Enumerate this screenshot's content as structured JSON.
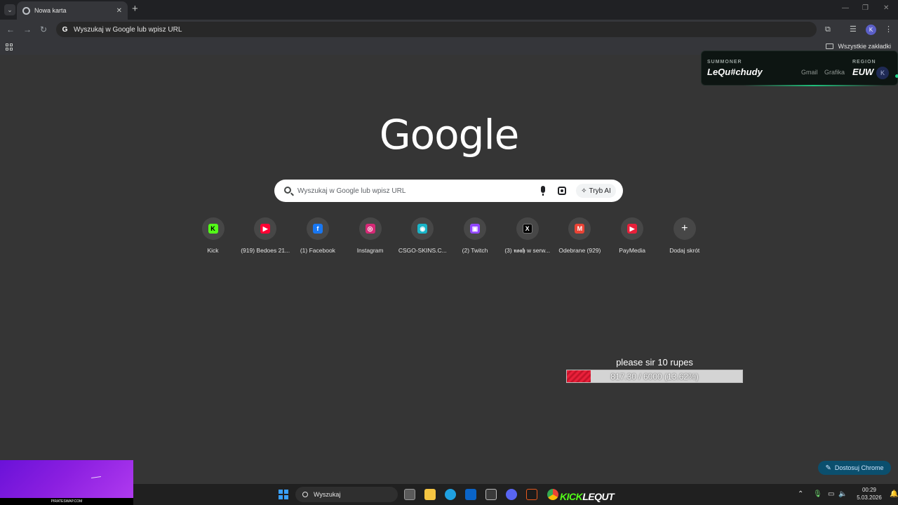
{
  "browser": {
    "tab": {
      "title": "Nowa karta"
    },
    "omnibox": {
      "text": "Wyszukaj w Google lub wpisz URL"
    },
    "profile_initial": "K",
    "bookmarks": {
      "all_label": "Wszystkie zakładki"
    }
  },
  "overlay": {
    "summoner_label": "SUMMONER",
    "summoner_name": "LeQu#chudy",
    "links": [
      "Gmail",
      "Grafika"
    ],
    "region_label": "REGION",
    "region_value": "EUW",
    "avatar_initial": "K"
  },
  "google": {
    "logo_text": "Google",
    "search_placeholder": "Wyszukaj w Google lub wpisz URL",
    "ai_mode_label": "Tryb AI"
  },
  "shortcuts": [
    {
      "label": "Kick",
      "icon": "kick-icon",
      "color": "#53fc18",
      "glyph": "K"
    },
    {
      "label": "(919) Bedoes 21...",
      "icon": "youtube-icon",
      "color": "#ff0033",
      "glyph": "▶"
    },
    {
      "label": "(1) Facebook",
      "icon": "facebook-icon",
      "color": "#1877f2",
      "glyph": "f"
    },
    {
      "label": "Instagram",
      "icon": "instagram-icon",
      "color": "#d62976",
      "glyph": "◎"
    },
    {
      "label": "CSGO-SKINS.C...",
      "icon": "csgo-skins-icon",
      "color": "#19b5c9",
      "glyph": "◉"
    },
    {
      "label": "(2) Twitch",
      "icon": "twitch-icon",
      "color": "#9146ff",
      "glyph": "▣"
    },
    {
      "label": "(3) 𝖓𝖔𝖆𝖍 w serw...",
      "icon": "x-icon",
      "color": "#000000",
      "glyph": "X"
    },
    {
      "label": "Odebrane (929)",
      "icon": "gmail-icon",
      "color": "#ea4335",
      "glyph": "M"
    },
    {
      "label": "PayMedia",
      "icon": "paymedia-icon",
      "color": "#e8203a",
      "glyph": "▶"
    },
    {
      "label": "Dodaj skrót",
      "icon": "plus-icon",
      "color": "#474747",
      "glyph": "+"
    }
  ],
  "donation": {
    "title": "please sir 10 rupes",
    "progress_text": "817.30 / 6000 (13.62%)",
    "progress_fraction": 0.1362
  },
  "customize": {
    "label": "Dostosuj Chrome"
  },
  "webcam": {
    "watermark": "PIRATESWAP.COM"
  },
  "taskbar": {
    "search_label": "Wyszukaj",
    "kick_text": "KICK",
    "kick_user": "LEQUT",
    "time": "00:29",
    "date": "5.03.2026"
  }
}
